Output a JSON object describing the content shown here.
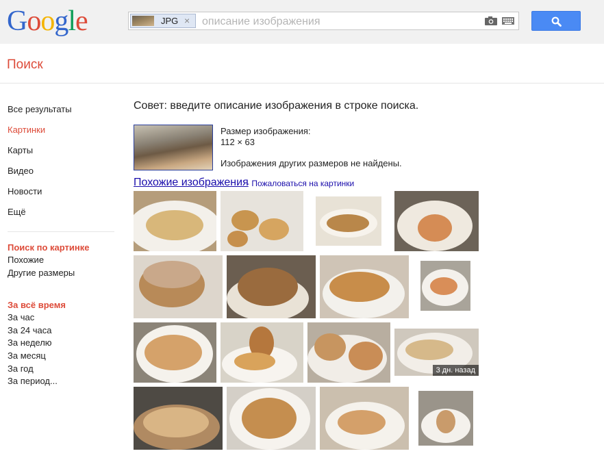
{
  "header": {
    "logo_text": "Google",
    "search": {
      "chip_label": "JPG",
      "chip_close": "×",
      "placeholder": "описание изображения",
      "value": ""
    }
  },
  "section_title": "Поиск",
  "sidebar": {
    "items": [
      {
        "label": "Все результаты",
        "active": false
      },
      {
        "label": "Картинки",
        "active": true
      },
      {
        "label": "Карты",
        "active": false
      },
      {
        "label": "Видео",
        "active": false
      },
      {
        "label": "Новости",
        "active": false
      },
      {
        "label": "Ещё",
        "active": false
      }
    ],
    "search_by_image": {
      "heading": "Поиск по картинке",
      "options": [
        "Похожие",
        "Другие размеры"
      ]
    },
    "time": {
      "heading": "За всё время",
      "options": [
        "За час",
        "За 24 часа",
        "За неделю",
        "За месяц",
        "За год",
        "За период..."
      ]
    }
  },
  "main": {
    "tip": "Совет: введите описание изображения в строке поиска.",
    "image_info": {
      "size_label": "Размер изображения:",
      "size_value": "112 × 63",
      "no_other_sizes": "Изображения других размеров не найдены."
    },
    "similar_link": "Похожие изображения",
    "report_link": "- Пожаловаться на картинки",
    "thumb_badge": "3 дн. назад"
  },
  "colors": {
    "accent_red": "#dd4b39",
    "link_blue": "#1a0dab",
    "search_button": "#4a8af4"
  }
}
